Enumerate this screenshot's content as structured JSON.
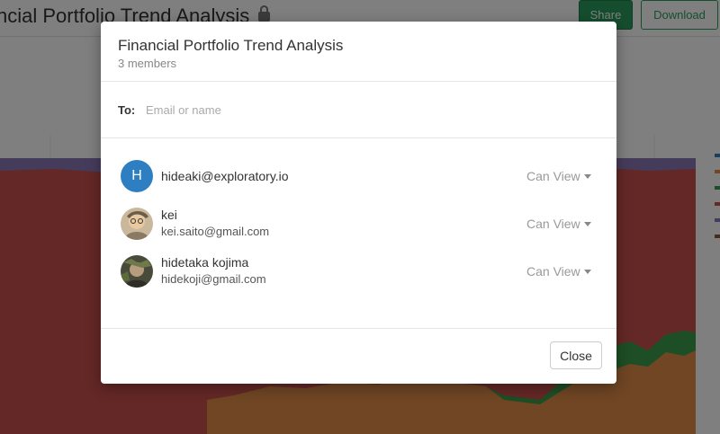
{
  "background": {
    "title": "ncial Portfolio Trend Analysis",
    "share_label": "Share",
    "download_label": "Download",
    "chart_colors": [
      "#c9504c",
      "#e08c48",
      "#3d9c4a",
      "#8b78b8"
    ],
    "legend_colors": [
      "#3a7ebf",
      "#e08c48",
      "#3d9c4a",
      "#c9504c",
      "#8b78b8",
      "#8b5a3c"
    ]
  },
  "modal": {
    "title": "Financial Portfolio Trend Analysis",
    "subtitle": "3 members",
    "to_label": "To:",
    "to_placeholder": "Email or name",
    "members": [
      {
        "avatar_letter": "H",
        "avatar_color": "#2d7fc1",
        "name": "hideaki@exploratory.io",
        "email": "",
        "permission": "Can View"
      },
      {
        "avatar_letter": "",
        "avatar_icon": "user-photo",
        "name": "kei",
        "email": "kei.saito@gmail.com",
        "permission": "Can View"
      },
      {
        "avatar_letter": "",
        "avatar_icon": "user-photo",
        "name": "hidetaka kojima",
        "email": "hidekoji@gmail.com",
        "permission": "Can View"
      }
    ],
    "close_label": "Close"
  }
}
